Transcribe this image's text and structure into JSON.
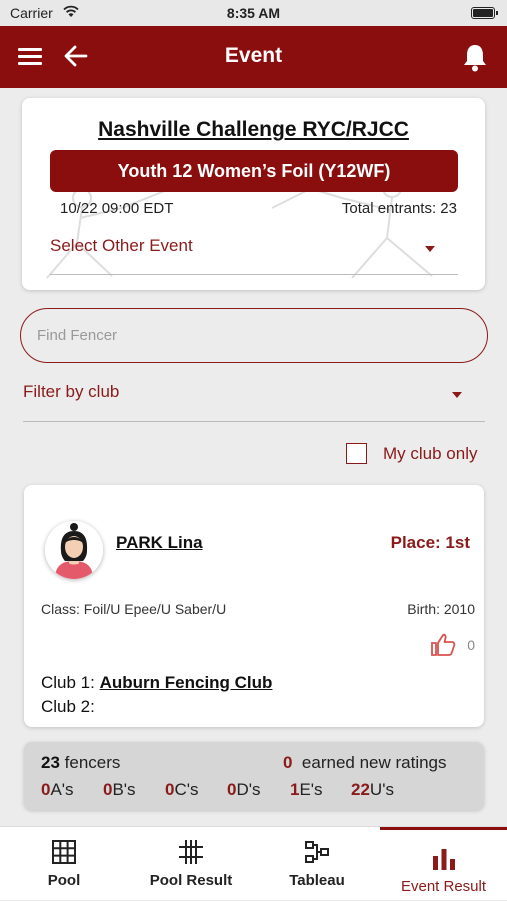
{
  "status_bar": {
    "carrier": "Carrier",
    "time": "8:35 AM"
  },
  "app_bar": {
    "title": "Event"
  },
  "event": {
    "title": "Nashville Challenge RYC/RJCC",
    "name": "Youth 12 Women’s Foil (Y12WF)",
    "datetime": "10/22 09:00 EDT",
    "entrants": "Total entrants: 23",
    "select_other": "Select Other Event"
  },
  "search": {
    "placeholder": "Find Fencer",
    "value": ""
  },
  "filter": {
    "label": "Filter by club"
  },
  "my_club": {
    "label": "My club only",
    "checked": false
  },
  "fencer": {
    "name": "PARK Lina",
    "place": "Place: 1st",
    "class": "Class: Foil/U Epee/U Saber/U",
    "birth": "Birth: 2010",
    "likes": "0",
    "club1_label": "Club 1:",
    "club1_value": "Auburn Fencing Club",
    "club2_label": "Club 2:",
    "club2_value": ""
  },
  "stats": {
    "fencers_count": "23",
    "fencers_label": "fencers",
    "new_ratings_count": "0",
    "new_ratings_label": "earned new ratings",
    "ratings": [
      {
        "count": "0",
        "label": "A's"
      },
      {
        "count": "0",
        "label": "B's"
      },
      {
        "count": "0",
        "label": "C's"
      },
      {
        "count": "0",
        "label": "D's"
      },
      {
        "count": "1",
        "label": "E's"
      },
      {
        "count": "22",
        "label": "U's"
      }
    ]
  },
  "tabs": [
    {
      "label": "Pool",
      "icon": "grid-icon",
      "active": false
    },
    {
      "label": "Pool Result",
      "icon": "hash-grid-icon",
      "active": false
    },
    {
      "label": "Tableau",
      "icon": "bracket-icon",
      "active": false
    },
    {
      "label": "Event Result",
      "icon": "bar-chart-icon",
      "active": true
    }
  ],
  "colors": {
    "primary": "#8b0e0e",
    "accent_text": "#8b1a1a",
    "background": "#ececec"
  }
}
